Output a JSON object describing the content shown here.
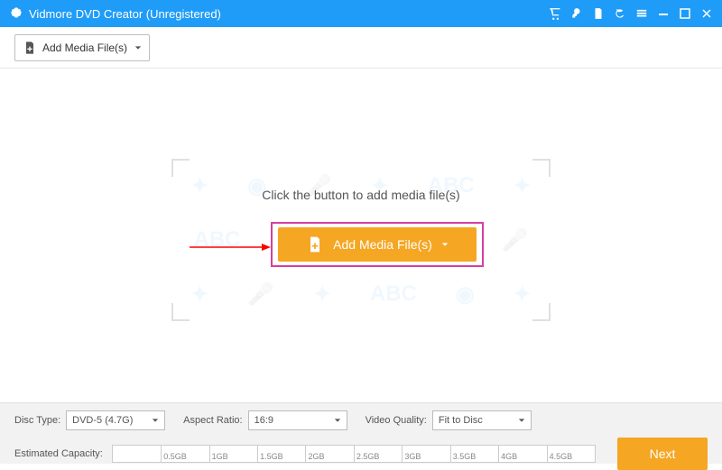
{
  "titlebar": {
    "title": "Vidmore DVD Creator (Unregistered)"
  },
  "topbar": {
    "add_media_label": "Add Media File(s)"
  },
  "dropzone": {
    "hint": "Click the button to add media file(s)",
    "button_label": "Add Media File(s)"
  },
  "bottom": {
    "disc_type_label": "Disc Type:",
    "disc_type_value": "DVD-5 (4.7G)",
    "aspect_label": "Aspect Ratio:",
    "aspect_value": "16:9",
    "quality_label": "Video Quality:",
    "quality_value": "Fit to Disc",
    "capacity_label": "Estimated Capacity:",
    "ticks": [
      "0.5GB",
      "1GB",
      "1.5GB",
      "2GB",
      "2.5GB",
      "3GB",
      "3.5GB",
      "4GB",
      "4.5GB"
    ],
    "next_label": "Next"
  }
}
